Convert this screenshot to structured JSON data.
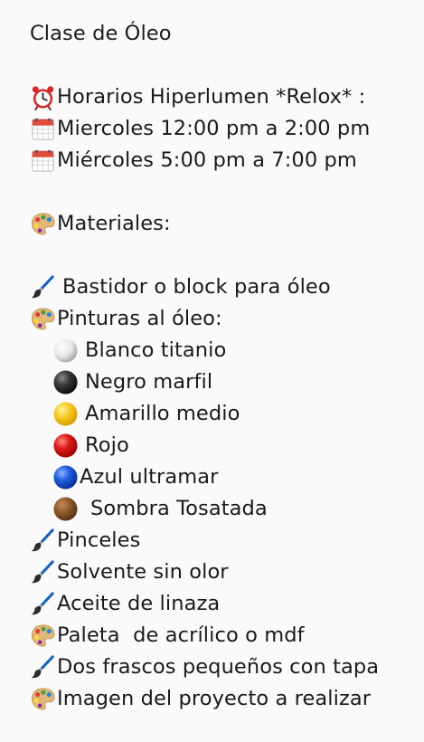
{
  "message": {
    "title": "Clase de Óleo",
    "schedule_header": "Horarios Hiperlumen *Relox* :",
    "schedule": [
      "Miercoles 12:00 pm a 2:00 pm",
      "Miércoles 5:00 pm a 7:00 pm"
    ],
    "materials_header": "Materiales:",
    "materials": [
      {
        "icon": "paintbrush-icon",
        "text": "Bastidor o block para óleo"
      },
      {
        "icon": "palette-icon",
        "text": "Pinturas al óleo:"
      }
    ],
    "paints": [
      {
        "icon": "white-circle-icon",
        "color": "#f2f2f2",
        "text": "Blanco titanio"
      },
      {
        "icon": "black-circle-icon",
        "color": "#2b2b2b",
        "text": "Negro marfil"
      },
      {
        "icon": "yellow-circle-icon",
        "color": "#f5c518",
        "text": "Amarillo medio"
      },
      {
        "icon": "red-circle-icon",
        "color": "#e01b1b",
        "text": "Rojo"
      },
      {
        "icon": "blue-circle-icon",
        "color": "#1f5fe0",
        "text": "Azul ultramar"
      },
      {
        "icon": "brown-circle-icon",
        "color": "#8b5a2b",
        "text": "Sombra Tosatada"
      }
    ],
    "more_materials": [
      {
        "icon": "paintbrush-icon",
        "text": "Pinceles"
      },
      {
        "icon": "paintbrush-icon",
        "text": "Solvente sin olor"
      },
      {
        "icon": "paintbrush-icon",
        "text": "Aceite de linaza"
      },
      {
        "icon": "palette-icon",
        "text": "Paleta  de acrílico o mdf"
      },
      {
        "icon": "paintbrush-icon",
        "text": "Dos frascos pequeños con tapa"
      },
      {
        "icon": "palette-icon",
        "text": "Imagen del proyecto a realizar"
      }
    ]
  }
}
